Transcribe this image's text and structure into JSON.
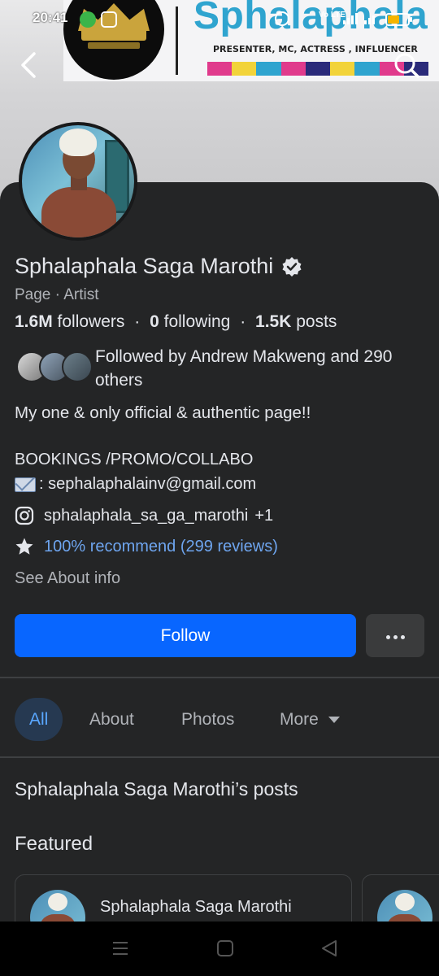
{
  "status_bar": {
    "time": "20:41",
    "network": "Vo LTE"
  },
  "cover": {
    "brand": "Sphalaphala",
    "tagline": "PRESENTER, MC, ACTRESS , INFLUENCER",
    "stripe_colors": [
      "#e03a8c",
      "#f2d33a",
      "#2fa4cf",
      "#e03a8c",
      "#2a2a7a",
      "#f2d33a",
      "#2fa4cf",
      "#e03a8c",
      "#2a2a7a"
    ]
  },
  "profile": {
    "name": "Sphalaphala Saga Marothi",
    "category": "Page · Artist",
    "stats": {
      "followers_count": "1.6M",
      "followers_label": "followers",
      "following_count": "0",
      "following_label": "following",
      "posts_count": "1.5K",
      "posts_label": "posts",
      "separator": "·"
    },
    "followed_by": {
      "prefix": "Followed by",
      "friend": "Andrew Makweng",
      "suffix": "and",
      "others": "290 others"
    },
    "bio": "My one & only official & authentic page!!",
    "booking_line1": "BOOKINGS /PROMO/COLLABO",
    "booking_line2": ": sephalaphalainv@gmail.com",
    "instagram_handle": "sphalaphala_sa_ga_marothi",
    "instagram_extra": "+1",
    "recommend": "100% recommend (299 reviews)",
    "about_link": "See About info"
  },
  "actions": {
    "follow_label": "Follow"
  },
  "tabs": [
    {
      "label": "All",
      "active": true
    },
    {
      "label": "About"
    },
    {
      "label": "Photos"
    },
    {
      "label": "More"
    }
  ],
  "posts_section": {
    "title": "Sphalaphala Saga Marothi’s posts",
    "featured_label": "Featured",
    "featured_author": "Sphalaphala Saga Marothi"
  },
  "colors": {
    "background": "#242526",
    "accent": "#0866ff",
    "link": "#6ea5ef"
  }
}
